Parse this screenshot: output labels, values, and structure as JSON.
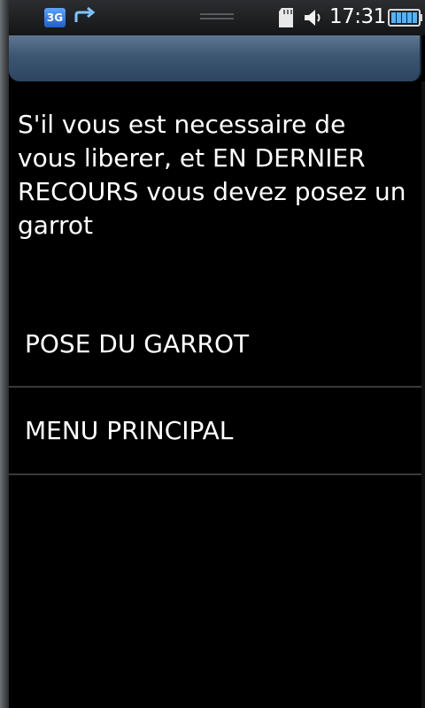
{
  "status_bar": {
    "network_label": "3G",
    "network_icon": "3g-icon",
    "sync_icon": "sync-icon",
    "sd_icon": "sd-card-icon",
    "volume_icon": "volume-icon",
    "time": "17:31",
    "battery_icon": "battery-icon",
    "accent_color": "#2e7bd6"
  },
  "title_bar": {
    "title": "",
    "color": "#3c5672"
  },
  "message": "S'il vous est necessaire de vous liberer, et EN DERNIER RECOURS vous devez posez un garrot",
  "menu": {
    "items": [
      {
        "label": "POSE DU GARROT"
      },
      {
        "label": "MENU PRINCIPAL"
      }
    ]
  }
}
